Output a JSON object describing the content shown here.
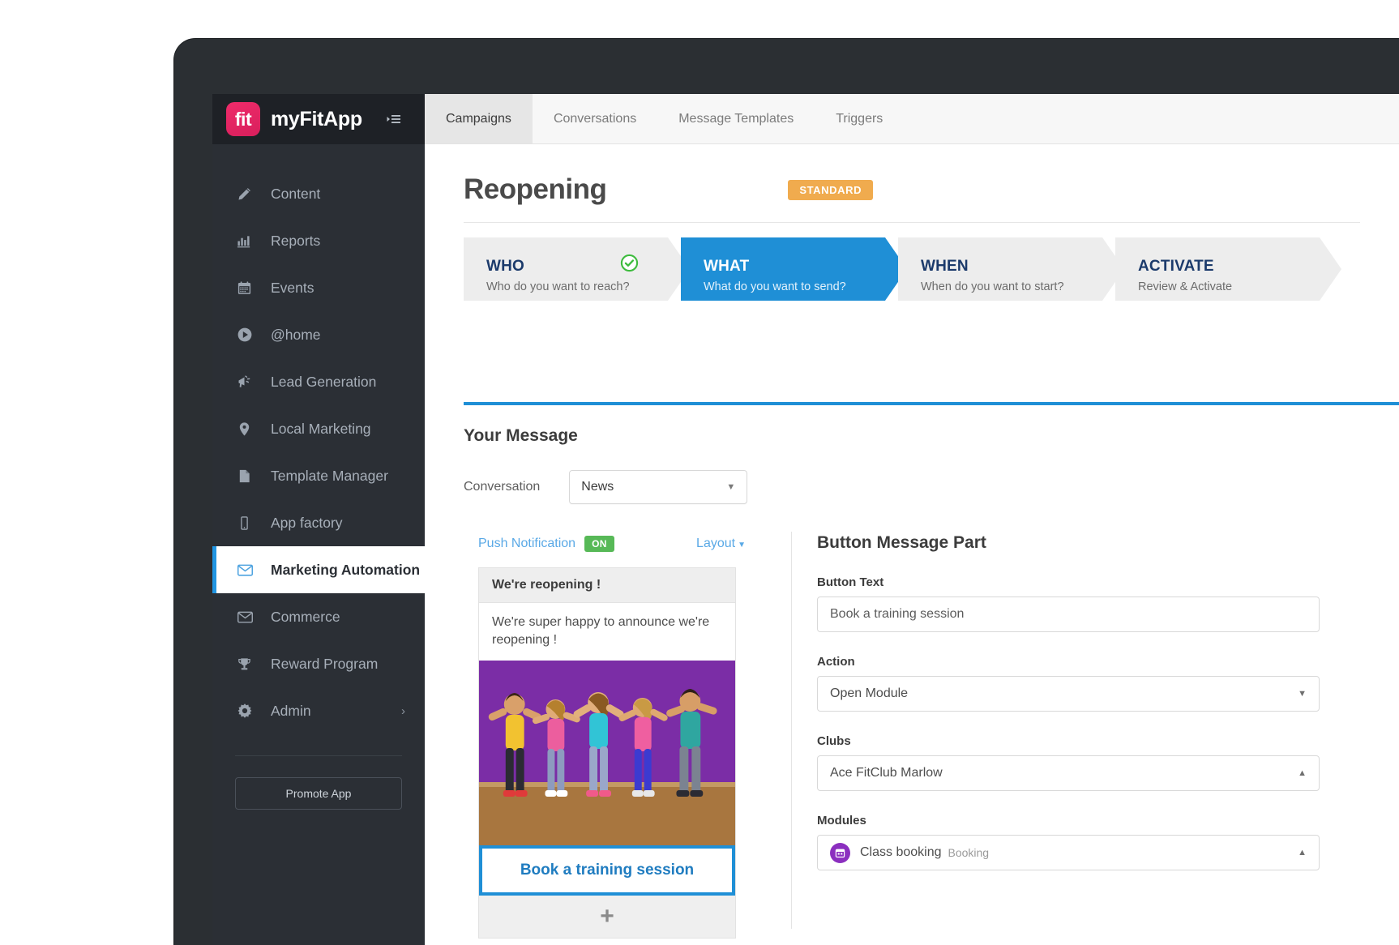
{
  "brand": {
    "logo_text": "fit",
    "name": "myFitApp",
    "collapse_icon": "collapse-menu-icon"
  },
  "sidebar": {
    "items": [
      {
        "label": "Content",
        "icon": "pencil-icon",
        "active": false
      },
      {
        "label": "Reports",
        "icon": "bar-chart-icon",
        "active": false
      },
      {
        "label": "Events",
        "icon": "calendar-icon",
        "active": false
      },
      {
        "label": "@home",
        "icon": "play-circle-icon",
        "active": false
      },
      {
        "label": "Lead Generation",
        "icon": "megaphone-icon",
        "active": false
      },
      {
        "label": "Local Marketing",
        "icon": "map-pin-icon",
        "active": false
      },
      {
        "label": "Template Manager",
        "icon": "document-icon",
        "active": false
      },
      {
        "label": "App factory",
        "icon": "mobile-phone-icon",
        "active": false
      },
      {
        "label": "Marketing Automation",
        "icon": "envelope-icon",
        "active": true
      },
      {
        "label": "Commerce",
        "icon": "envelope-icon",
        "active": false
      },
      {
        "label": "Reward Program",
        "icon": "trophy-icon",
        "active": false
      },
      {
        "label": "Admin",
        "icon": "gear-icon",
        "active": false,
        "chevron": "›"
      }
    ],
    "promote_button": "Promote App"
  },
  "tabs": [
    {
      "label": "Campaigns",
      "active": true
    },
    {
      "label": "Conversations",
      "active": false
    },
    {
      "label": "Message Templates",
      "active": false
    },
    {
      "label": "Triggers",
      "active": false
    }
  ],
  "page": {
    "title": "Reopening",
    "status_badge": "STANDARD",
    "badge_color": "#f0ab4e"
  },
  "wizard": {
    "accent_color": "#1f8fd6",
    "steps": [
      {
        "title": "WHO",
        "subtitle": "Who do you want to reach?",
        "active": false,
        "complete": true
      },
      {
        "title": "WHAT",
        "subtitle": "What do you want to send?",
        "active": true,
        "complete": false
      },
      {
        "title": "WHEN",
        "subtitle": "When do you want to start?",
        "active": false,
        "complete": false
      },
      {
        "title": "ACTIVATE",
        "subtitle": "Review & Activate",
        "active": false,
        "complete": false
      }
    ]
  },
  "message": {
    "heading": "Your Message",
    "conversation_label": "Conversation",
    "conversation_value": "News",
    "push_notification_label": "Push Notification",
    "push_notification_state": "ON",
    "push_state_color": "#57b957",
    "layout_label": "Layout",
    "preview": {
      "title": "We're reopening !",
      "body": "We're super happy to announce we're reopening !",
      "image_alt": "group-fitness-dancers-photo",
      "button_text": "Book a training session",
      "add_part_icon": "plus-icon"
    }
  },
  "form": {
    "title": "Button Message Part",
    "fields": [
      {
        "label": "Button Text",
        "value": "Book a training session",
        "type": "input"
      },
      {
        "label": "Action",
        "value": "Open Module",
        "type": "select",
        "caret": "down"
      },
      {
        "label": "Clubs",
        "value": "Ace FitClub Marlow",
        "type": "select",
        "caret": "up"
      },
      {
        "label": "Modules",
        "value": "Class booking",
        "sub": "Booking",
        "type": "select",
        "caret": "up",
        "icon": "calendar-booking-icon",
        "icon_color": "#8b2fbf"
      }
    ]
  }
}
